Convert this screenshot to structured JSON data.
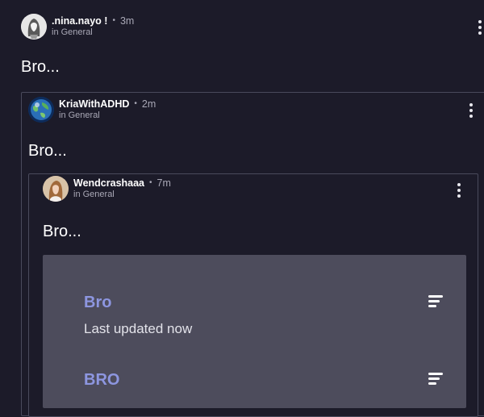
{
  "post1": {
    "username": ".nina.nayo !",
    "time": "3m",
    "channel": "in General",
    "body": "Bro..."
  },
  "post2": {
    "username": "KriaWithADHD",
    "time": "2m",
    "channel": "in General",
    "body": "Bro..."
  },
  "post3": {
    "username": "Wendcrashaaa",
    "time": "7m",
    "channel": "in General",
    "body": "Bro..."
  },
  "poll": {
    "options": [
      {
        "title": "Bro",
        "subtitle": "Last updated now"
      },
      {
        "title": "BRO"
      }
    ]
  },
  "icons": {
    "more": "more-vertical-icon",
    "list": "list-lines-icon"
  },
  "colors": {
    "background": "#1c1b29",
    "accent": "#8d96e0",
    "poll_bg": "#4d4c5c"
  }
}
